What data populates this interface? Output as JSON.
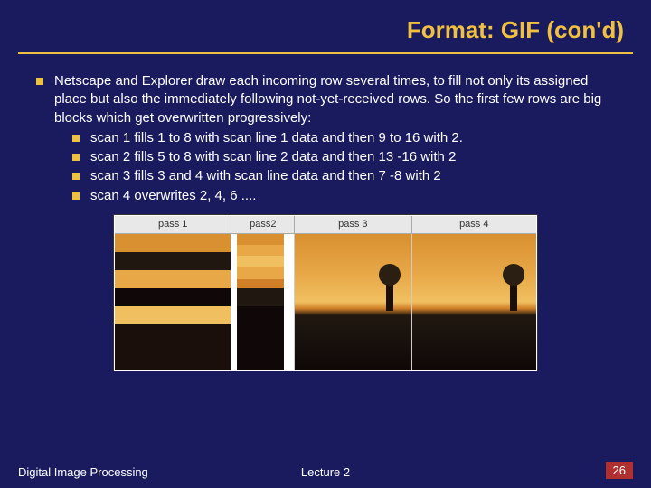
{
  "title": "Format: GIF (con'd)",
  "main_bullet": "Netscape and Explorer draw each incoming row several times, to fill not only its assigned place but also the immediately following not-yet-received rows. So the first few rows are big blocks which get overwritten progressively:",
  "sub_bullets": [
    "scan 1 fills 1 to 8 with scan line 1 data and then 9 to 16 with 2.",
    "scan 2 fills 5 to 8 with scan line 2 data and then 13 -16 with 2",
    "scan 3 fills 3 and 4 with scan line data and then 7 -8 with 2",
    "scan 4 overwrites 2, 4, 6 ...."
  ],
  "figure": {
    "labels": [
      "pass 1",
      "pass2",
      "pass 3",
      "pass 4"
    ]
  },
  "footer": {
    "left": "Digital Image Processing",
    "center": "Lecture 2",
    "right": "26"
  }
}
